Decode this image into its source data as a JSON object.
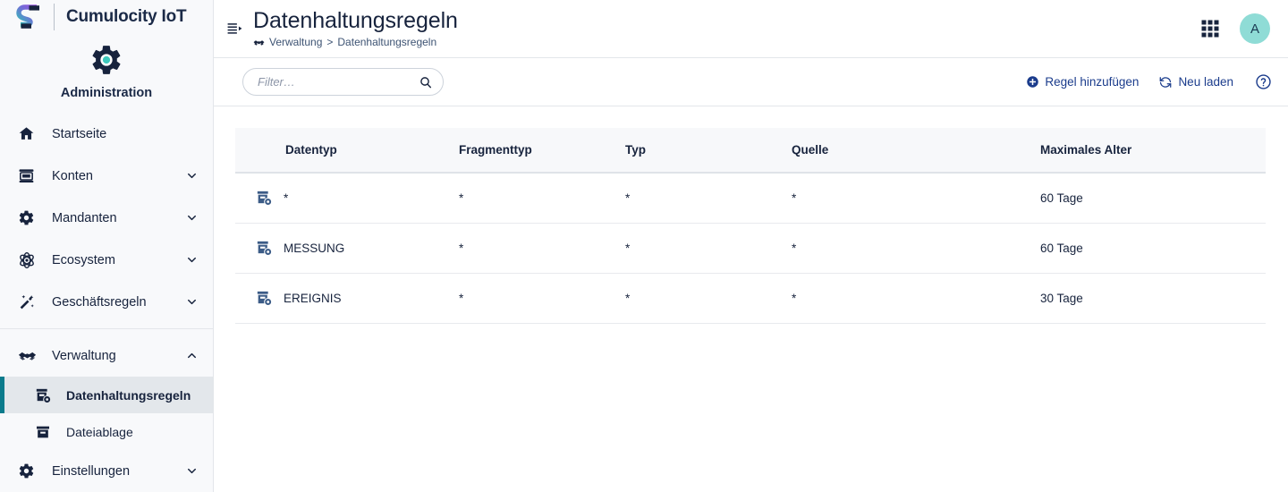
{
  "brand": {
    "logo_icon": "software-ag-logo",
    "title": "Cumulocity IoT"
  },
  "sidebar": {
    "app_icon": "gear-icon",
    "app_label": "Administration",
    "items": [
      {
        "label": "Startseite",
        "icon": "home-icon",
        "caret": null,
        "expanded": false
      },
      {
        "label": "Konten",
        "icon": "accounts-icon",
        "caret": "chevron-down-icon",
        "expanded": false
      },
      {
        "label": "Mandanten",
        "icon": "gear-icon",
        "caret": "chevron-down-icon",
        "expanded": false
      },
      {
        "label": "Ecosystem",
        "icon": "atom-icon",
        "caret": "chevron-down-icon",
        "expanded": false
      },
      {
        "label": "Geschäftsregeln",
        "icon": "wand-icon",
        "caret": "chevron-down-icon",
        "expanded": false
      },
      {
        "label": "Verwaltung",
        "icon": "handshake-icon",
        "caret": "chevron-up-icon",
        "expanded": true
      }
    ],
    "sub_items": [
      {
        "label": "Datenhaltungsregeln",
        "icon": "retention-rule-icon",
        "active": true
      },
      {
        "label": "Dateiablage",
        "icon": "archive-icon",
        "active": false
      }
    ],
    "trailing_items": [
      {
        "label": "Einstellungen",
        "icon": "gear-icon",
        "caret": "chevron-down-icon",
        "expanded": false
      }
    ],
    "active_accent_color": "#0b7b8c"
  },
  "header": {
    "collapse_icon": "collapse-menu-icon",
    "title": "Datenhaltungsregeln",
    "breadcrumb": {
      "icon": "handshake-icon",
      "parent": "Verwaltung",
      "separator": ">",
      "current": "Datenhaltungsregeln"
    },
    "app_switcher_icon": "grid-apps-icon",
    "avatar_initial": "A",
    "avatar_color": "#8fdcd6"
  },
  "toolbar": {
    "filter_placeholder": "Filter…",
    "filter_value": "",
    "search_icon": "search-icon",
    "add_rule_label": "Regel hinzufügen",
    "add_rule_icon": "plus-circle-icon",
    "reload_label": "Neu laden",
    "reload_icon": "refresh-icon",
    "help_icon": "question-circle-icon",
    "link_color": "#1b3c8c"
  },
  "table": {
    "columns": [
      "Datentyp",
      "Fragmenttyp",
      "Typ",
      "Quelle",
      "Maximales Alter"
    ],
    "rows": [
      {
        "icon": "retention-rule-icon",
        "datentyp": "*",
        "fragmenttyp": "*",
        "typ": "*",
        "quelle": "*",
        "maximales_alter": "60 Tage"
      },
      {
        "icon": "retention-rule-icon",
        "datentyp": "MESSUNG",
        "fragmenttyp": "*",
        "typ": "*",
        "quelle": "*",
        "maximales_alter": "60 Tage"
      },
      {
        "icon": "retention-rule-icon",
        "datentyp": "EREIGNIS",
        "fragmenttyp": "*",
        "typ": "*",
        "quelle": "*",
        "maximales_alter": "30 Tage"
      }
    ]
  }
}
